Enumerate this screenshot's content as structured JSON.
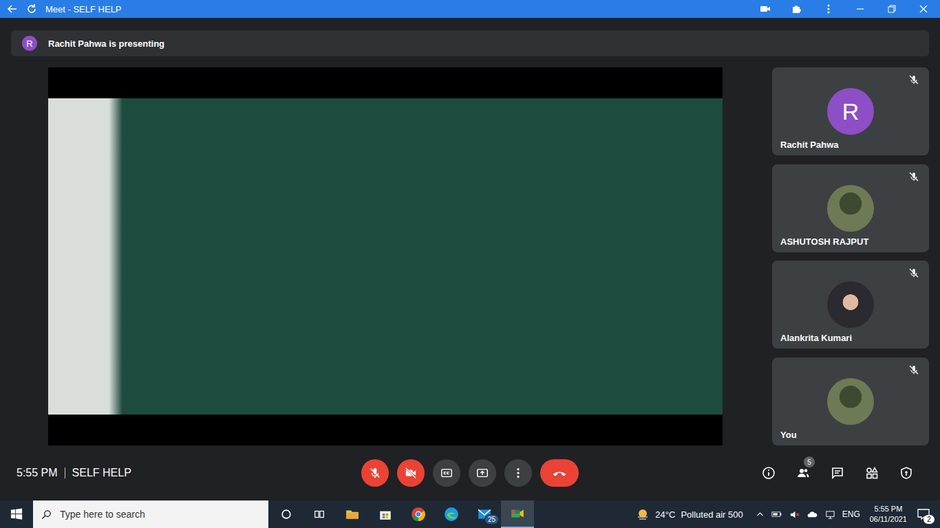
{
  "window": {
    "title": "Meet - SELF HELP"
  },
  "presenting": {
    "avatar": "R",
    "text": "Rachit Pahwa is presenting"
  },
  "participants": [
    {
      "name": "Rachit Pahwa",
      "kind": "letter",
      "avatar": "R",
      "muted": true
    },
    {
      "name": "ASHUTOSH RAJPUT",
      "kind": "photo",
      "avatar": "",
      "muted": true
    },
    {
      "name": "Alankrita Kumari",
      "kind": "photo",
      "avatar": "",
      "muted": true
    },
    {
      "name": "You",
      "kind": "photo",
      "avatar": "",
      "muted": true
    }
  ],
  "meeting": {
    "time": "5:55 PM",
    "name": "SELF HELP"
  },
  "controls": [
    {
      "kind": "mic",
      "off": true
    },
    {
      "kind": "camera",
      "off": true
    },
    {
      "kind": "captions",
      "off": false
    },
    {
      "kind": "present",
      "off": false
    },
    {
      "kind": "more",
      "off": false
    },
    {
      "kind": "hangup",
      "off": false
    }
  ],
  "side_buttons": [
    {
      "kind": "info",
      "badge": ""
    },
    {
      "kind": "people",
      "badge": "5"
    },
    {
      "kind": "chat",
      "badge": ""
    },
    {
      "kind": "activities",
      "badge": ""
    },
    {
      "kind": "host",
      "badge": ""
    }
  ],
  "taskbar": {
    "search_placeholder": "Type here to search",
    "apps": [
      {
        "kind": "cortana",
        "badge": "",
        "active": false
      },
      {
        "kind": "task-view",
        "badge": "",
        "active": false
      },
      {
        "kind": "explorer",
        "badge": "",
        "active": false
      },
      {
        "kind": "store",
        "badge": "",
        "active": false
      },
      {
        "kind": "chrome",
        "badge": "",
        "active": false
      },
      {
        "kind": "edge",
        "badge": "",
        "active": false
      },
      {
        "kind": "mail",
        "badge": "25",
        "active": false
      },
      {
        "kind": "meet",
        "badge": "",
        "active": true
      }
    ],
    "weather": {
      "temp": "24°C",
      "text": "Polluted air 500"
    },
    "language": "ENG",
    "time": "5:55 PM",
    "date": "06/11/2021",
    "notifications": "2"
  }
}
